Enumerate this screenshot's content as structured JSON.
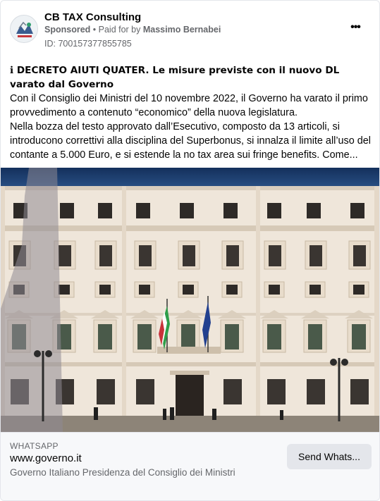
{
  "header": {
    "page_name": "CB TAX Consulting",
    "sponsored_label": "Sponsored",
    "separator": " • ",
    "paid_for_label": "Paid for by ",
    "payer": "Massimo Bernabei",
    "ad_id_label": "ID: 700157377855785",
    "more_icon": "more-horizontal-icon",
    "more_glyph": "•••"
  },
  "post": {
    "headline": "ℹ DECRETO AIUTI QUATER. Le misure previste con il nuovo DL varato dal Governo",
    "paragraph1": "Con il Consiglio dei Ministri del 10 novembre 2022, il Governo ha varato il primo provvedimento a contenuto “economico” della nuova legislatura.",
    "paragraph2": "Nella bozza del testo approvato dall’Esecutivo, composto da 13 articoli, si introducono correttivi alla disciplina del Superbonus, si innalza il limite all’uso del contante a 5.000 Euro, e si estende la no tax area sui fringe benefits. Come..."
  },
  "media": {
    "description": "photo",
    "sky_color": "#1f3a66",
    "facade_color": "#efe6da"
  },
  "footer": {
    "caption": "WHATSAPP",
    "url": "www.governo.it",
    "description": "Governo Italiano Presidenza del Consiglio dei Ministri",
    "cta_label": "Send Whats..."
  }
}
